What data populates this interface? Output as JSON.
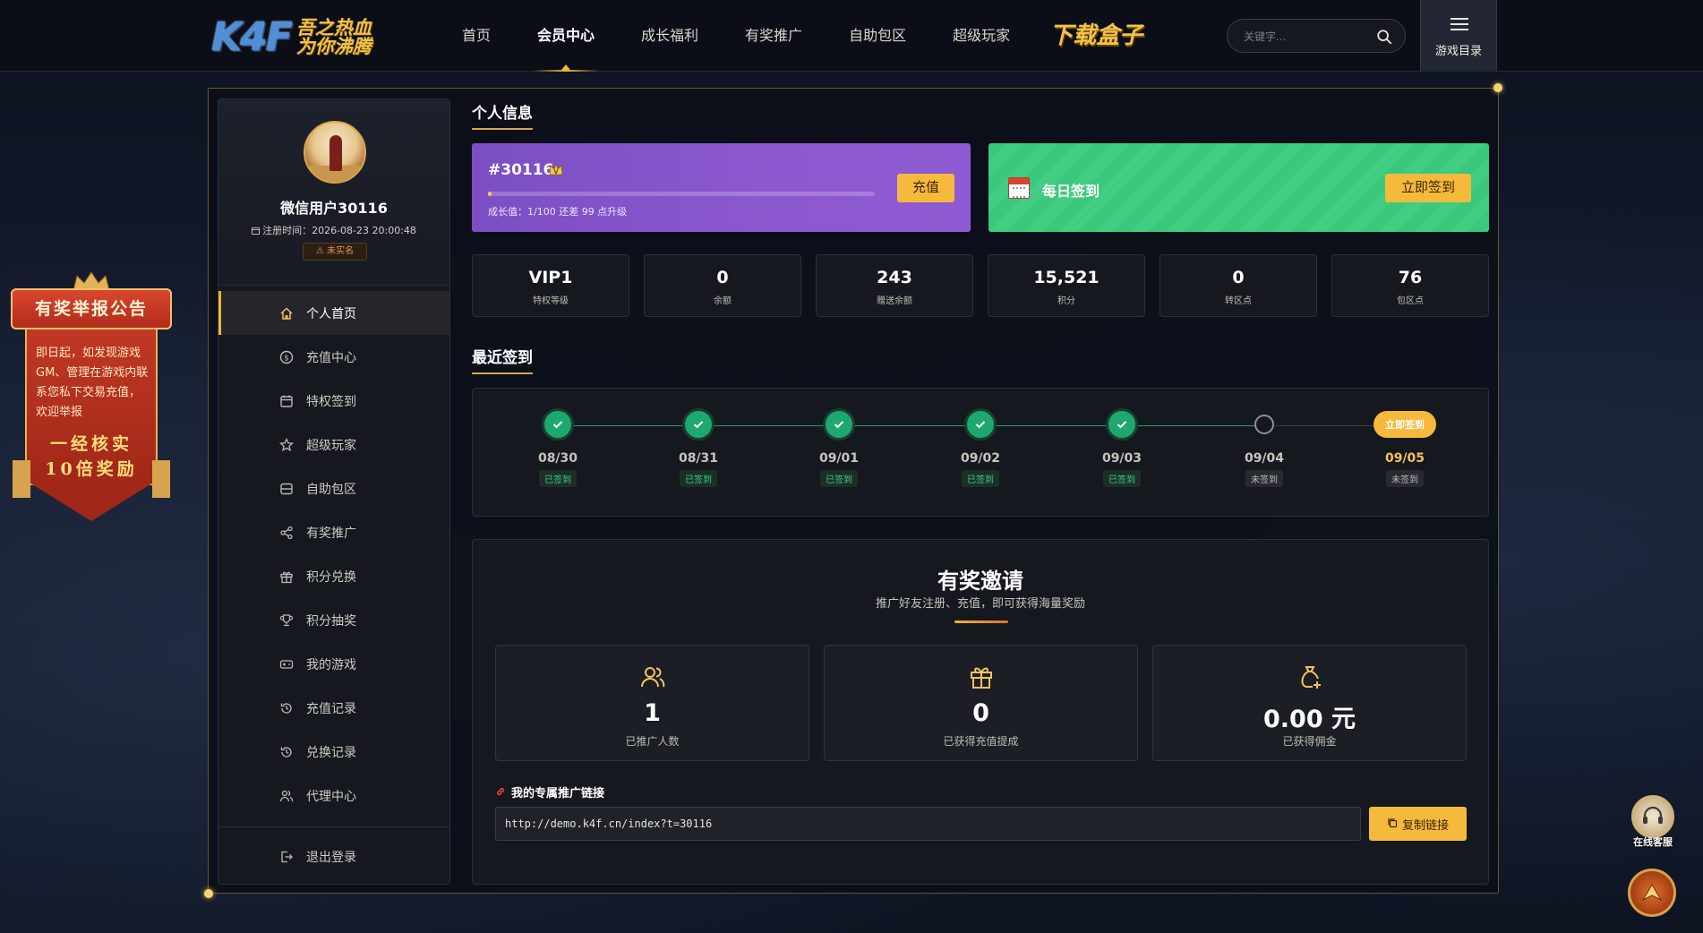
{
  "header": {
    "logo_text": "K4F",
    "logo_slogan": "吾之热血 为你沸腾",
    "nav": [
      "首页",
      "会员中心",
      "成长福利",
      "有奖推广",
      "自助包区",
      "超级玩家"
    ],
    "download_label": "下载盒子",
    "search_placeholder": "关键字...",
    "game_dir_label": "游戏目录"
  },
  "profile": {
    "username": "微信用户30116",
    "reg_time": "注册时间：2026-08-23 20:00:48",
    "realname_status": "未实名"
  },
  "menu": {
    "items": [
      {
        "label": "个人首页",
        "icon": "home-icon"
      },
      {
        "label": "充值中心",
        "icon": "dollar-icon"
      },
      {
        "label": "特权签到",
        "icon": "calendar-icon"
      },
      {
        "label": "超级玩家",
        "icon": "star-icon"
      },
      {
        "label": "自助包区",
        "icon": "server-icon"
      },
      {
        "label": "有奖推广",
        "icon": "share-icon"
      },
      {
        "label": "积分兑换",
        "icon": "gift-icon"
      },
      {
        "label": "积分抽奖",
        "icon": "trophy-icon"
      },
      {
        "label": "我的游戏",
        "icon": "gamepad-icon"
      },
      {
        "label": "充值记录",
        "icon": "history-icon"
      },
      {
        "label": "兑换记录",
        "icon": "history-icon"
      },
      {
        "label": "代理中心",
        "icon": "users-icon"
      }
    ],
    "logout": "退出登录"
  },
  "personal_info": {
    "title": "个人信息",
    "user_id": "#30116",
    "growth_text": "成长值：1/100 还差 99 点升级",
    "growth_progress": 0.01,
    "recharge_button": "充值",
    "daily_sign_label": "每日签到",
    "sign_button": "立即签到"
  },
  "stats": [
    {
      "value": "VIP1",
      "label": "特权等级"
    },
    {
      "value": "0",
      "label": "余额"
    },
    {
      "value": "243",
      "label": "赠送余额"
    },
    {
      "value": "15,521",
      "label": "积分"
    },
    {
      "value": "0",
      "label": "转区点"
    },
    {
      "value": "76",
      "label": "包区点"
    }
  ],
  "recent_sign": {
    "title": "最近签到",
    "days": [
      {
        "date": "08/30",
        "status": "已签到"
      },
      {
        "date": "08/31",
        "status": "已签到"
      },
      {
        "date": "09/01",
        "status": "已签到"
      },
      {
        "date": "09/02",
        "status": "已签到"
      },
      {
        "date": "09/03",
        "status": "已签到"
      },
      {
        "date": "09/04",
        "status": "未签到"
      },
      {
        "date": "09/05",
        "status": "未签到",
        "button": "立即签到"
      }
    ]
  },
  "invite": {
    "title": "有奖邀请",
    "subtitle": "推广好友注册、充值，即可获得海量奖励",
    "cards": [
      {
        "value": "1",
        "label": "已推广人数",
        "icon": "users-icon"
      },
      {
        "value": "0",
        "label": "已获得充值提成",
        "icon": "gift-icon"
      },
      {
        "value": "0.00 元",
        "label": "已获得佣金",
        "icon": "money-bag-icon"
      }
    ],
    "link_label": "我的专属推广链接",
    "link_value": "http://demo.k4f.cn/index?t=30116",
    "copy_button": "复制链接"
  },
  "announcement": {
    "title": "有奖举报公告",
    "text": "即日起，如发现游戏GM、管理在游戏内联系您私下交易充值，欢迎举报",
    "slogan_line1": "一经核实",
    "slogan_line2": "10倍奖励"
  },
  "floating": {
    "service_label": "在线客服"
  },
  "colors": {
    "accent": "#f5b93c",
    "vip_card": "#8c58cf",
    "sign_card": "#3bc77c",
    "success": "#1fa86e"
  }
}
